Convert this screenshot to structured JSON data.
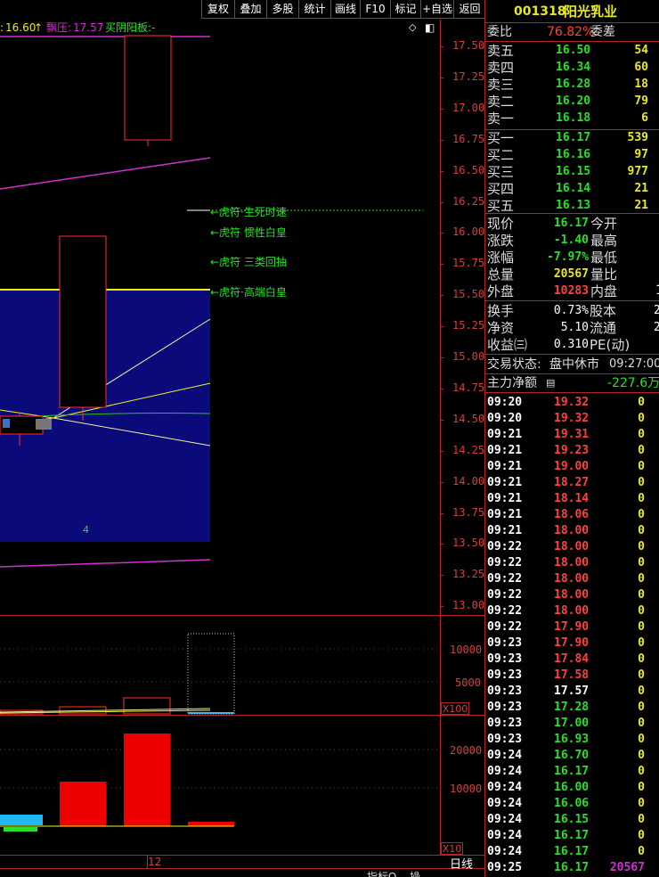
{
  "toolbar": {
    "buttons": [
      "复权",
      "叠加",
      "多股",
      "统计",
      "画线",
      "F10",
      "标记",
      "+自选",
      "返回"
    ]
  },
  "info_bar": {
    "price_label": "16.60",
    "up_arrow": "↑",
    "float_label": "飘压:",
    "float_value": "17.57",
    "pattern_label": "买阴阳板:",
    "pattern_value": "-",
    "diamond_icon": "◇",
    "panel_toggle_icon": "◧"
  },
  "chart": {
    "price_axis": [
      "17.50",
      "17.25",
      "17.00",
      "16.75",
      "16.50",
      "16.25",
      "16.00",
      "15.75",
      "15.50",
      "15.25",
      "15.00",
      "14.75",
      "14.50",
      "14.25",
      "14.00",
      "13.75",
      "13.50",
      "13.25",
      "13.00"
    ],
    "volume_axis": [
      "10000",
      "5000"
    ],
    "volume_multiplier": "X100",
    "amount_axis": [
      "20000",
      "10000"
    ],
    "amount_multiplier": "X10",
    "bar_count_label": "4",
    "date_marker": "12",
    "annotations": [
      "←虎符·生死时速",
      "←虎符 惯性白皇",
      "←虎符 三类回抽",
      "←虎符·高端白皇"
    ]
  },
  "bottom_tabs": [
    "指标Ω",
    "操",
    "日线"
  ],
  "stock": {
    "code": "001318",
    "name": "阳光乳业"
  },
  "order_book": {
    "ratio_label": "委比",
    "ratio_value": "76.82%",
    "diff_label": "委差",
    "asks": [
      {
        "label": "卖五",
        "price": "16.50",
        "vol": "54"
      },
      {
        "label": "卖四",
        "price": "16.34",
        "vol": "60"
      },
      {
        "label": "卖三",
        "price": "16.28",
        "vol": "18"
      },
      {
        "label": "卖二",
        "price": "16.20",
        "vol": "79"
      },
      {
        "label": "卖一",
        "price": "16.18",
        "vol": "6"
      }
    ],
    "bids": [
      {
        "label": "买一",
        "price": "16.17",
        "vol": "539"
      },
      {
        "label": "买二",
        "price": "16.16",
        "vol": "97"
      },
      {
        "label": "买三",
        "price": "16.15",
        "vol": "977"
      },
      {
        "label": "买四",
        "price": "16.14",
        "vol": "21"
      },
      {
        "label": "买五",
        "price": "16.13",
        "vol": "21"
      }
    ]
  },
  "quote": {
    "rows": [
      {
        "l1": "现价",
        "v1": "16.17",
        "l2": "今开"
      },
      {
        "l1": "涨跌",
        "v1": "-1.40",
        "l2": "最高"
      },
      {
        "l1": "涨幅",
        "v1": "-7.97%",
        "l2": "最低"
      },
      {
        "l1": "总量",
        "v1": "20567",
        "l2": "量比"
      },
      {
        "l1": "外盘",
        "v1": "10283",
        "l2": "内盘"
      }
    ],
    "rows2": [
      {
        "l1": "换手",
        "v1": "0.73%",
        "l2": "股本",
        "v2": "2"
      },
      {
        "l1": "净资",
        "v1": "5.10",
        "l2": "流通",
        "v2": "2"
      },
      {
        "l1": "收益㈢",
        "v1": "0.310",
        "l2": "PE(动)",
        "v2": ""
      }
    ],
    "inner_partial": "1",
    "status_label": "交易状态:",
    "status_value": "盘中休市",
    "status_time": "09:27:00",
    "main_flow_label": "主力净额",
    "main_flow_value": "-227.6万"
  },
  "ticks": [
    {
      "t": "09:20",
      "p": "19.32",
      "v": "0",
      "c": "r"
    },
    {
      "t": "09:20",
      "p": "19.32",
      "v": "0",
      "c": "r"
    },
    {
      "t": "09:21",
      "p": "19.31",
      "v": "0",
      "c": "r"
    },
    {
      "t": "09:21",
      "p": "19.23",
      "v": "0",
      "c": "r"
    },
    {
      "t": "09:21",
      "p": "19.00",
      "v": "0",
      "c": "r"
    },
    {
      "t": "09:21",
      "p": "18.27",
      "v": "0",
      "c": "r"
    },
    {
      "t": "09:21",
      "p": "18.14",
      "v": "0",
      "c": "r"
    },
    {
      "t": "09:21",
      "p": "18.06",
      "v": "0",
      "c": "r"
    },
    {
      "t": "09:21",
      "p": "18.00",
      "v": "0",
      "c": "r"
    },
    {
      "t": "09:22",
      "p": "18.00",
      "v": "0",
      "c": "r"
    },
    {
      "t": "09:22",
      "p": "18.00",
      "v": "0",
      "c": "r"
    },
    {
      "t": "09:22",
      "p": "18.00",
      "v": "0",
      "c": "r"
    },
    {
      "t": "09:22",
      "p": "18.00",
      "v": "0",
      "c": "r"
    },
    {
      "t": "09:22",
      "p": "18.00",
      "v": "0",
      "c": "r"
    },
    {
      "t": "09:22",
      "p": "17.90",
      "v": "0",
      "c": "r"
    },
    {
      "t": "09:23",
      "p": "17.90",
      "v": "0",
      "c": "r"
    },
    {
      "t": "09:23",
      "p": "17.84",
      "v": "0",
      "c": "r"
    },
    {
      "t": "09:23",
      "p": "17.58",
      "v": "0",
      "c": "r"
    },
    {
      "t": "09:23",
      "p": "17.57",
      "v": "0",
      "c": "w"
    },
    {
      "t": "09:23",
      "p": "17.28",
      "v": "0",
      "c": "g"
    },
    {
      "t": "09:23",
      "p": "17.00",
      "v": "0",
      "c": "g"
    },
    {
      "t": "09:23",
      "p": "16.93",
      "v": "0",
      "c": "g"
    },
    {
      "t": "09:24",
      "p": "16.70",
      "v": "0",
      "c": "g"
    },
    {
      "t": "09:24",
      "p": "16.17",
      "v": "0",
      "c": "g"
    },
    {
      "t": "09:24",
      "p": "16.00",
      "v": "0",
      "c": "g"
    },
    {
      "t": "09:24",
      "p": "16.06",
      "v": "0",
      "c": "g"
    },
    {
      "t": "09:24",
      "p": "16.15",
      "v": "0",
      "c": "g"
    },
    {
      "t": "09:24",
      "p": "16.17",
      "v": "0",
      "c": "g"
    },
    {
      "t": "09:24",
      "p": "16.17",
      "v": "0",
      "c": "g"
    },
    {
      "t": "09:25",
      "p": "16.17",
      "v": "20567",
      "c": "g",
      "vc": "m"
    }
  ]
}
